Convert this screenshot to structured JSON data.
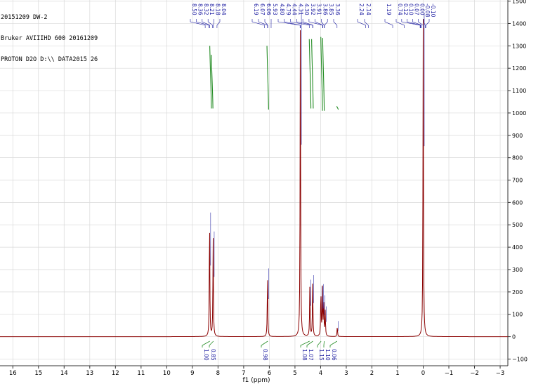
{
  "header": {
    "line1": "20151209 DW-2",
    "line2": "Bruker AVIIIHD 600 20161209",
    "line3": "PROTON D2O D:\\\\ DATA2015 26"
  },
  "colors": {
    "spectrum": "#8b0000",
    "integral": "#228b22",
    "peak_label": "#1a1aa0",
    "grid": "#d9d9d9",
    "axis": "#333333"
  },
  "chart_data": {
    "type": "line",
    "title": "",
    "xlabel": "f1 (ppm)",
    "ylabel": "",
    "xlim": [
      16.5,
      -3.3
    ],
    "ylim": [
      -130,
      1505
    ],
    "x_reversed": true,
    "grid": true,
    "x_ticks": [
      16,
      15,
      14,
      13,
      12,
      11,
      10,
      9,
      8,
      7,
      6,
      5,
      4,
      3,
      2,
      1,
      0,
      -1,
      -2,
      -3
    ],
    "x_tick_labels": [
      "16",
      "15",
      "14",
      "13",
      "12",
      "11",
      "10",
      "9",
      "8",
      "7",
      "6",
      "5",
      "4",
      "3",
      "2",
      "1",
      "0",
      "−1",
      "−2",
      "−3"
    ],
    "y_ticks": [
      -100,
      0,
      100,
      200,
      300,
      400,
      500,
      600,
      700,
      800,
      900,
      1000,
      1100,
      1200,
      1300,
      1400,
      1500
    ],
    "y_tick_labels": [
      "−100",
      "0",
      "100",
      "200",
      "300",
      "400",
      "500",
      "600",
      "700",
      "800",
      "900",
      "1000",
      "1100",
      "1200",
      "1300",
      "1400",
      "1500"
    ],
    "peaks": [
      {
        "ppm": 8.33,
        "height": 530
      },
      {
        "ppm": 8.19,
        "height": 445
      },
      {
        "ppm": 6.07,
        "height": 280
      },
      {
        "ppm": 4.79,
        "height": 1430
      },
      {
        "ppm": 4.42,
        "height": 230
      },
      {
        "ppm": 4.31,
        "height": 250
      },
      {
        "ppm": 3.99,
        "height": 200
      },
      {
        "ppm": 3.93,
        "height": 210
      },
      {
        "ppm": 3.88,
        "height": 160
      },
      {
        "ppm": 3.82,
        "height": 110
      },
      {
        "ppm": 3.35,
        "height": 45
      },
      {
        "ppm": 0.0,
        "height": 1420
      }
    ],
    "peak_labels": [
      "8.50",
      "8.36",
      "8.32",
      "8.21",
      "8.18",
      "8.04",
      "6.19",
      "6.07",
      "6.06",
      "5.93",
      "4.80",
      "4.79",
      "4.44",
      "4.31",
      "4.30",
      "3.92",
      "3.91",
      "3.86",
      "3.85",
      "3.36",
      "2.24",
      "2.14",
      "1.19",
      "0.74",
      "0.12",
      "0.10",
      "0.07",
      "0.00",
      "-0.08",
      "-0.10"
    ],
    "integral_curves": [
      {
        "ppm": 8.3,
        "top": 1300,
        "bottom": 1020
      },
      {
        "ppm": 8.24,
        "top": 1260,
        "bottom": 1020
      },
      {
        "ppm": 6.07,
        "top": 1300,
        "bottom": 1015
      },
      {
        "ppm": 4.42,
        "top": 1330,
        "bottom": 1020
      },
      {
        "ppm": 4.33,
        "top": 1330,
        "bottom": 1020
      },
      {
        "ppm": 3.97,
        "top": 1340,
        "bottom": 1010
      },
      {
        "ppm": 3.9,
        "top": 1335,
        "bottom": 1010
      },
      {
        "ppm": 3.35,
        "top": 1030,
        "bottom": 1015
      }
    ],
    "integrals": [
      {
        "ppm": 8.32,
        "label": "1.00"
      },
      {
        "ppm": 8.18,
        "label": "0.85"
      },
      {
        "ppm": 6.06,
        "label": "0.98"
      },
      {
        "ppm": 4.43,
        "label": "1.08"
      },
      {
        "ppm": 4.3,
        "label": "1.07"
      },
      {
        "ppm": 3.98,
        "label": "1.15"
      },
      {
        "ppm": 3.86,
        "label": "1.10"
      },
      {
        "ppm": 3.36,
        "label": "0.06"
      }
    ]
  }
}
